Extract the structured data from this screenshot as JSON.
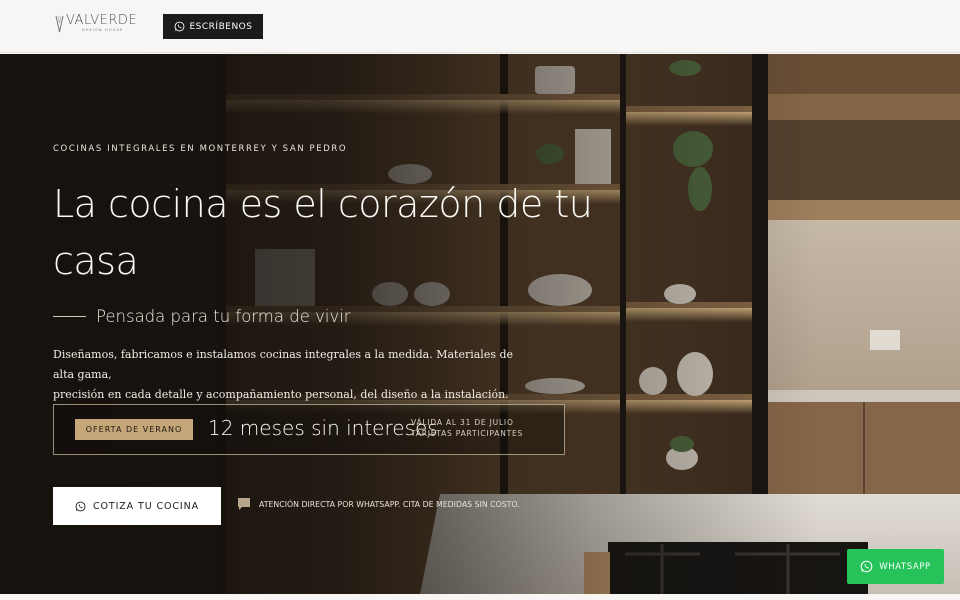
{
  "brand": {
    "name": "VALVERDE",
    "tagline": "DESIGN HOUSE"
  },
  "header": {
    "cta_label": "ESCRÍBENOS"
  },
  "hero": {
    "eyebrow": "COCINAS INTEGRALES EN MONTERREY Y SAN PEDRO",
    "title_line1": "La cocina es el corazón de tu",
    "title_line2": "casa",
    "subtitle": "Pensada para tu forma de vivir",
    "description_line1": "Diseñamos, fabricamos e instalamos cocinas integrales a la medida. Materiales de alta gama,",
    "description_line2": "precisión en cada detalle y acompañamiento personal, del diseño a la instalación.",
    "offer": {
      "tag": "OFERTA DE VERANO",
      "headline": "12 meses sin intereses",
      "validity_line1": "VÁLIDA AL 31 DE JULIO",
      "validity_line2": "TARJETAS PARTICIPANTES"
    },
    "cta_label": "COTIZA TU COCINA",
    "note": "ATENCIÓN DIRECTA POR WHATSAPP. CITA DE MEDIDAS SIN COSTO."
  },
  "floating": {
    "whatsapp_label": "WHATSAPP"
  },
  "icons": {
    "header_button": "whatsapp-icon",
    "cta": "whatsapp-icon",
    "note": "chat-bubble-icon",
    "floating": "whatsapp-icon"
  },
  "colors": {
    "header_button_bg": "#1b1b1b",
    "offer_tag_bg": "#c4a679",
    "whatsapp_green": "#25c35a"
  }
}
